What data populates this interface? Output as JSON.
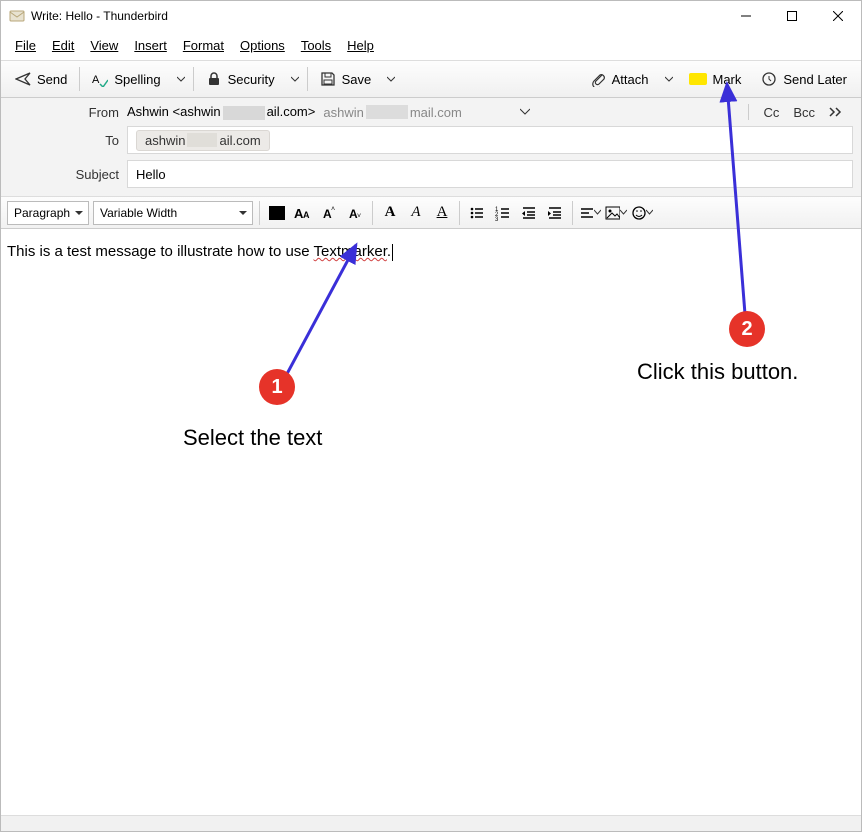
{
  "window": {
    "title": "Write: Hello - Thunderbird"
  },
  "menus": {
    "file": "File",
    "edit": "Edit",
    "view": "View",
    "insert": "Insert",
    "format": "Format",
    "options": "Options",
    "tools": "Tools",
    "help": "Help"
  },
  "toolbar": {
    "send": "Send",
    "spelling": "Spelling",
    "security": "Security",
    "save": "Save",
    "attach": "Attach",
    "mark": "Mark",
    "sendlater": "Send Later"
  },
  "headers": {
    "from_label": "From",
    "from_name": "Ashwin <ashwin",
    "from_suffix": "ail.com>",
    "from_alt_prefix": "ashwin",
    "from_alt_suffix": "mail.com",
    "cc": "Cc",
    "bcc": "Bcc",
    "to_label": "To",
    "to_prefix": "ashwin",
    "to_suffix": "ail.com",
    "subject_label": "Subject",
    "subject_value": "Hello"
  },
  "format": {
    "para": "Paragraph",
    "font": "Variable Width"
  },
  "body": {
    "prefix": "This is a test message to illustrate how to use ",
    "marked": "Textmarker",
    "suffix": "."
  },
  "annotations": {
    "num1": "1",
    "label1": "Select the text",
    "num2": "2",
    "label2": "Click this button."
  }
}
